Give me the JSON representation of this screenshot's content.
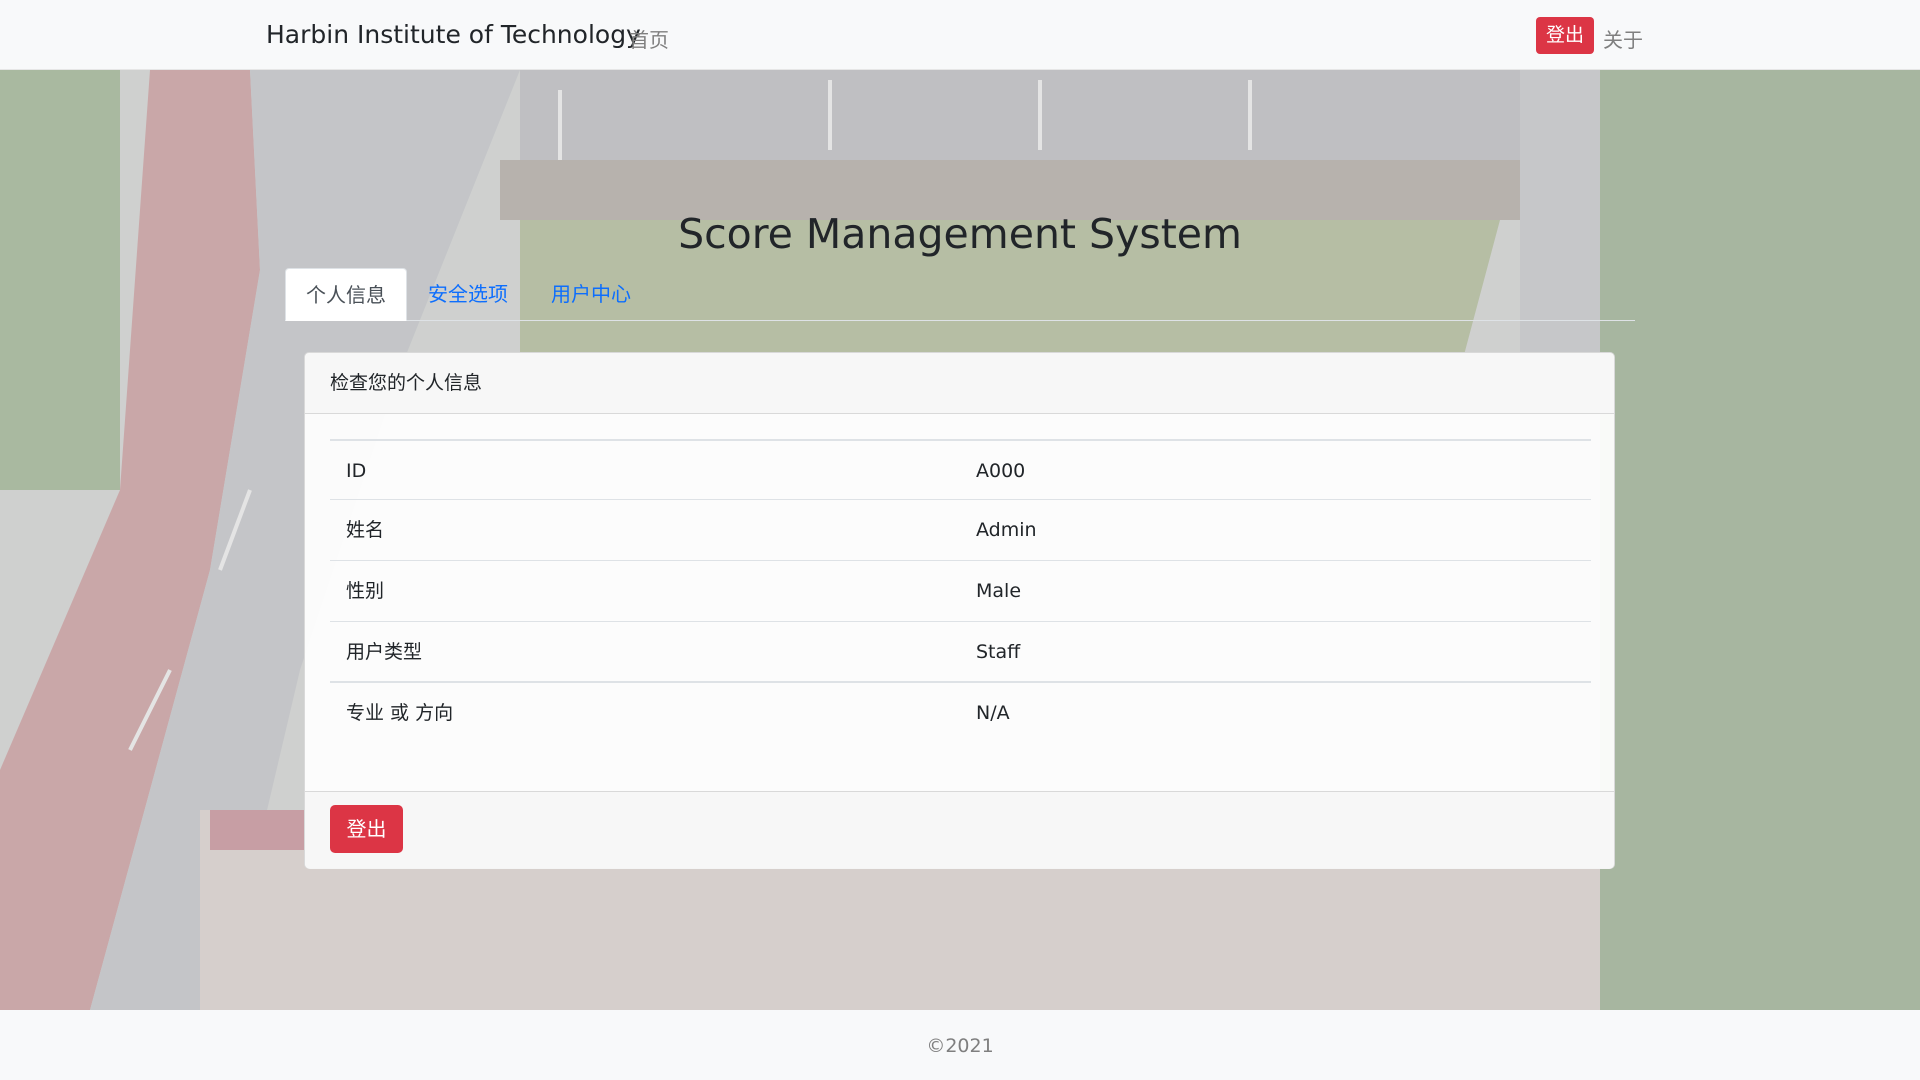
{
  "navbar": {
    "brand": "Harbin Institute of Technology",
    "home": "首页",
    "logout": "登出",
    "about": "关于"
  },
  "page": {
    "title": "Score Management System"
  },
  "tabs": [
    {
      "label": "个人信息",
      "active": true
    },
    {
      "label": "安全选项",
      "active": false
    },
    {
      "label": "用户中心",
      "active": false
    }
  ],
  "card": {
    "header": "检查您的个人信息",
    "rows": [
      {
        "key": "ID",
        "value": "A000"
      },
      {
        "key": "姓名",
        "value": "Admin"
      },
      {
        "key": "性别",
        "value": "Male"
      },
      {
        "key": "用户类型",
        "value": "Staff"
      },
      {
        "key": "专业 或 方向",
        "value": "N/A"
      }
    ],
    "logout_button": "登出"
  },
  "footer": {
    "copyright": "©2021"
  },
  "colors": {
    "danger": "#dc3545",
    "link": "#0d6efd",
    "navbar_bg": "#f8f9fa"
  }
}
